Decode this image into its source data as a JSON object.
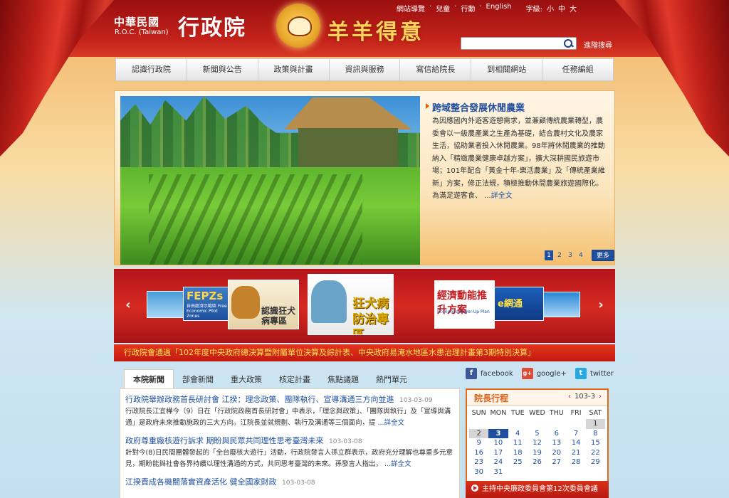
{
  "header": {
    "org_cn": "中華民國",
    "org_en": "R.O.C. (Taiwan)",
    "site_name": "行政院",
    "slogan": "羊羊得意",
    "util_links": [
      "網站導覽",
      "兒童",
      "行動",
      "English"
    ],
    "font_size_label": "字級:",
    "font_sizes": [
      "小",
      "中",
      "大"
    ],
    "search_placeholder": "",
    "advanced_search": "進階搜尋"
  },
  "nav": [
    "認識行政院",
    "新聞與公告",
    "政策與計畫",
    "資訊與服務",
    "寫信給院長",
    "到相關網站",
    "任務編組"
  ],
  "feature": {
    "title": "跨域整合發展休閒農業",
    "text": "為因應國內外遊客遊憩需求，並兼顧傳統農業轉型，農委會以一級農產業之生產為基礎，結合農村文化及農家生活，協助業者投入休閒農業。98年將休閒農業的推動納入「精緻農業健康卓越方案」，擴大深耕國民旅遊市場；101年配合「黃金十年-樂活農業」及「傳統產業維新」方案，修正法規，積極推動休閒農業旅遊國際化。為滿足遊客食、 ...",
    "more": "詳全文",
    "pages": [
      "1",
      "2",
      "3",
      "4"
    ],
    "active_page": "1",
    "more_button": "更多"
  },
  "carousel": {
    "ads": [
      {
        "name": "banner-1",
        "text": ""
      },
      {
        "name": "fepzs",
        "text": "FEPZs",
        "sub": "自由經濟示範區 Free Economic Pilot Zones"
      },
      {
        "name": "rabies-dog",
        "text": "認識狂犬病專區"
      },
      {
        "name": "rabies-prevention",
        "text": "狂犬病防治專區"
      },
      {
        "name": "economic-power-up",
        "text": "經濟動能推升方案",
        "sub": "Economic Power-Up Plan"
      },
      {
        "name": "banner-6",
        "text": "e網通"
      },
      {
        "name": "banner-7",
        "text": ""
      }
    ]
  },
  "marquee": "行政院會通過「102年度中央政府總決算暨附屬單位決算及綜計表、中央政府易淹水地區水患治理計畫第3期特別決算」",
  "tabs": [
    "本院新聞",
    "部會新聞",
    "重大政策",
    "核定計畫",
    "焦點議題",
    "熱門單元"
  ],
  "news": [
    {
      "title": "行政院舉辦政務首長研討會 江揆：理念政策、團隊執行、宣導溝通三方向並進",
      "date": "103-03-09",
      "desc": "行政院長江宜樺今（9）日在「行政院政務首長研討會」中表示，「理念與政策」、「團隊與執行」及「宣導與溝通」是政府未來推動施政的三大方向。江院長並就規劃、執行及溝通等三個面向，提",
      "more": "...詳全文"
    },
    {
      "title": "政府尊重廠核遊行訴求 期盼與民眾共同理性思考臺灣未來",
      "date": "103-03-08",
      "desc": "針對今(8)日民間團體發起的「全台廢核大遊行」活動，行政院發言人孫立群表示，政府充分理解也尊重多元意見，期盼能與社會各界持續以理性溝通的方式，共同思考臺灣的未來。孫發言人指出，",
      "more": "...詳全文"
    },
    {
      "title": "江揆責成各機關落實資產活化 健全國家財政",
      "date": "103-03-08",
      "desc": "",
      "more": ""
    }
  ],
  "social": [
    {
      "icon": "facebook-icon",
      "glyph": "f",
      "label": "facebook"
    },
    {
      "icon": "google-plus-icon",
      "glyph": "g+",
      "label": "google+"
    },
    {
      "icon": "twitter-icon",
      "glyph": "t",
      "label": "twitter"
    }
  ],
  "calendar": {
    "title": "院長行程",
    "month": "103-3",
    "days_of_week": [
      "SUN",
      "MON",
      "TUE",
      "WED",
      "THU",
      "FRI",
      "SAT"
    ],
    "weeks": [
      [
        "",
        "",
        "",
        "",
        "",
        "",
        "1"
      ],
      [
        "2",
        "3",
        "4",
        "5",
        "6",
        "7",
        "8"
      ],
      [
        "9",
        "10",
        "11",
        "12",
        "13",
        "14",
        "15"
      ],
      [
        "16",
        "17",
        "18",
        "19",
        "20",
        "21",
        "22"
      ],
      [
        "23",
        "24",
        "25",
        "26",
        "27",
        "28",
        "29"
      ],
      [
        "30",
        "31",
        "",
        "",
        "",
        "",
        ""
      ]
    ],
    "today": "3",
    "gray_days": [
      "1",
      "2"
    ],
    "footer": "主持中央廉政委員會第12次委員會議"
  },
  "colors": {
    "header_red": "#c3221a",
    "link_blue": "#1f4f9f",
    "accent_orange": "#e26b1a",
    "marquee_yellow": "#ffe65a"
  }
}
